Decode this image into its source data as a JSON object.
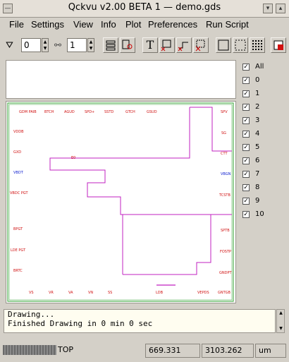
{
  "window": {
    "title": "Qckvu v2.00 BETA 1 — demo.gds"
  },
  "menu": {
    "items": [
      {
        "label": "File"
      },
      {
        "label": "Settings"
      },
      {
        "label": "View"
      },
      {
        "label": "Info"
      },
      {
        "label": "Plot"
      },
      {
        "label": "Preferences"
      },
      {
        "label": "Run Script"
      }
    ]
  },
  "toolbar": {
    "filter_value": "0",
    "depth_value": "1",
    "text_button": "T"
  },
  "layers": {
    "items": [
      {
        "label": "All",
        "checked": true
      },
      {
        "label": "0",
        "checked": true
      },
      {
        "label": "1",
        "checked": true
      },
      {
        "label": "2",
        "checked": true
      },
      {
        "label": "3",
        "checked": true
      },
      {
        "label": "4",
        "checked": true
      },
      {
        "label": "5",
        "checked": true
      },
      {
        "label": "6",
        "checked": true
      },
      {
        "label": "7",
        "checked": true
      },
      {
        "label": "8",
        "checked": true
      },
      {
        "label": "9",
        "checked": true
      },
      {
        "label": "10",
        "checked": true
      }
    ]
  },
  "drawing": {
    "colors": {
      "outline": "#30a030",
      "wire": "#c020c0",
      "text": "#d01010",
      "alt_text": "#1020d0"
    },
    "labels": [
      "GDM PAIB",
      "BTCH",
      "AGUD",
      "SPD+",
      "SSTD",
      "GTCH",
      "GSUD",
      "SPV",
      "SG",
      "CTT",
      "VBGN",
      "TCSTB",
      "SPTB",
      "FOSTP",
      "GNDPT",
      "GNTGB",
      "VDDB",
      "GXD",
      "VBDT",
      "VBDC PGT",
      "BPGT",
      "LDE PGT",
      "BRTC",
      "VS",
      "VR",
      "VA",
      "VN",
      "SS",
      "LDB",
      "VEPDS",
      "E0"
    ]
  },
  "log": {
    "line1": "Drawing...",
    "line2": "Finished Drawing in 0 min 0 sec"
  },
  "status": {
    "cell": "TOP",
    "x": "669.331",
    "y": "3103.262",
    "unit": "um"
  }
}
